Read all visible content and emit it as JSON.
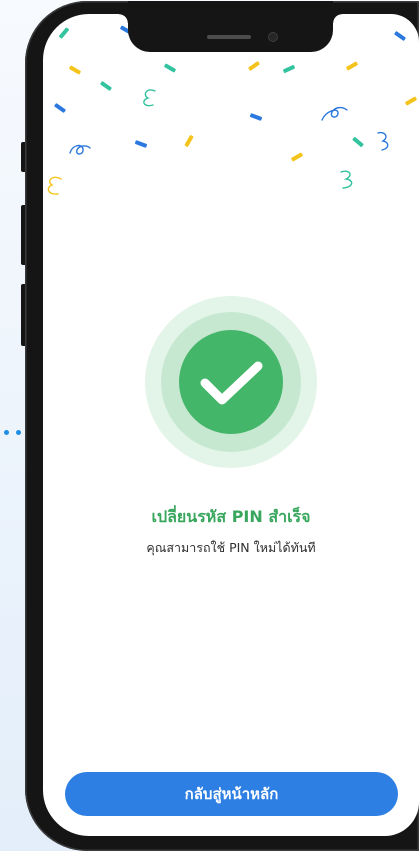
{
  "screen": {
    "title": "เปลี่ยนรหัส PIN สำเร็จ",
    "message": "คุณสามารถใช้ PIN ใหม่ได้ทันที",
    "primary_button_label": "กลับสู่หน้าหลัก"
  },
  "icons": {
    "status": "check-circle-icon",
    "background": "confetti-icon"
  },
  "theme": {
    "page_bg_top": "#f7fafe",
    "page_bg_bottom": "#e3eefa",
    "accent_dots": "#1f8fe6",
    "device_frame": "#151515",
    "screen_bg": "#ffffff",
    "success": "#44b66a",
    "success_text": "#38a75d",
    "success_ring_inner": "#c6e8d0",
    "success_ring_outer": "#e3f4e8",
    "primary": "#2d7fe3",
    "on_primary": "#ffffff",
    "body_text": "#2f2f2f",
    "confetti": [
      "#f4c41c",
      "#34c39f",
      "#2b78de"
    ]
  }
}
